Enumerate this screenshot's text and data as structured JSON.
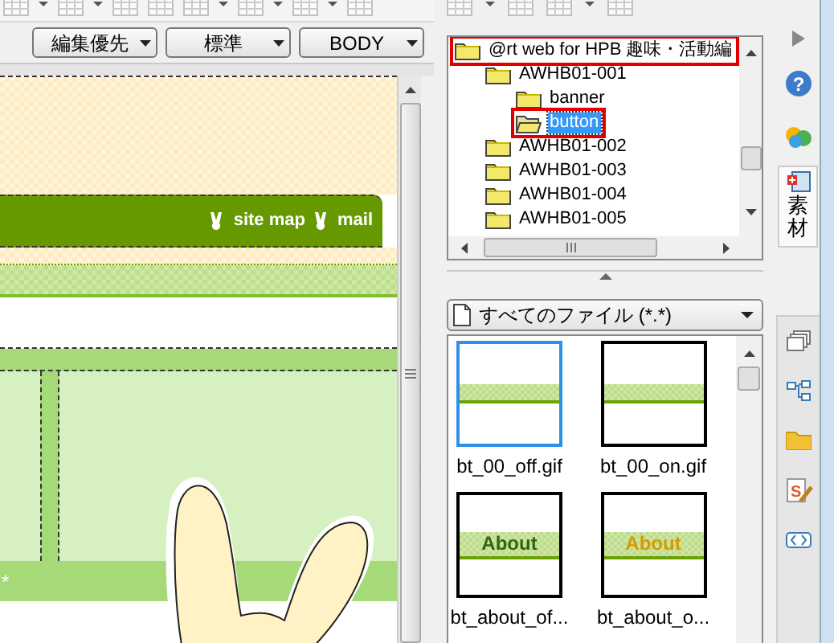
{
  "toolbar": {
    "dropdowns": [
      {
        "label": "編集優先"
      },
      {
        "label": "標準"
      },
      {
        "label": "BODY"
      }
    ]
  },
  "editor": {
    "nav_links": [
      {
        "label": "site map"
      },
      {
        "label": "mail"
      }
    ],
    "band_mark": "*"
  },
  "material_tree": {
    "items": [
      {
        "label": "@rt web for HPB 趣味・活動編",
        "selected": false,
        "highlighted": true,
        "children": [
          {
            "label": "AWHB01-001",
            "selected": false,
            "highlighted": false,
            "children": [
              {
                "label": "banner",
                "selected": false,
                "highlighted": false
              },
              {
                "label": "button",
                "selected": true,
                "highlighted": true
              }
            ]
          },
          {
            "label": "AWHB01-002",
            "selected": false,
            "highlighted": false
          },
          {
            "label": "AWHB01-003",
            "selected": false,
            "highlighted": false
          },
          {
            "label": "AWHB01-004",
            "selected": false,
            "highlighted": false
          },
          {
            "label": "AWHB01-005",
            "selected": false,
            "highlighted": false
          }
        ]
      }
    ]
  },
  "file_filter": {
    "label": "すべてのファイル (*.*)"
  },
  "thumbnails": [
    {
      "name": "bt_00_off.gif",
      "kind": "plain",
      "selected": true
    },
    {
      "name": "bt_00_on.gif",
      "kind": "plain",
      "selected": false
    },
    {
      "name": "bt_about_of...",
      "kind": "about-off",
      "label": "About",
      "selected": false
    },
    {
      "name": "bt_about_o...",
      "kind": "about-on",
      "label": "About",
      "selected": false
    }
  ],
  "side_strip": {
    "help_glyph": "?",
    "script_glyph": "S",
    "tab_label": "素材"
  }
}
